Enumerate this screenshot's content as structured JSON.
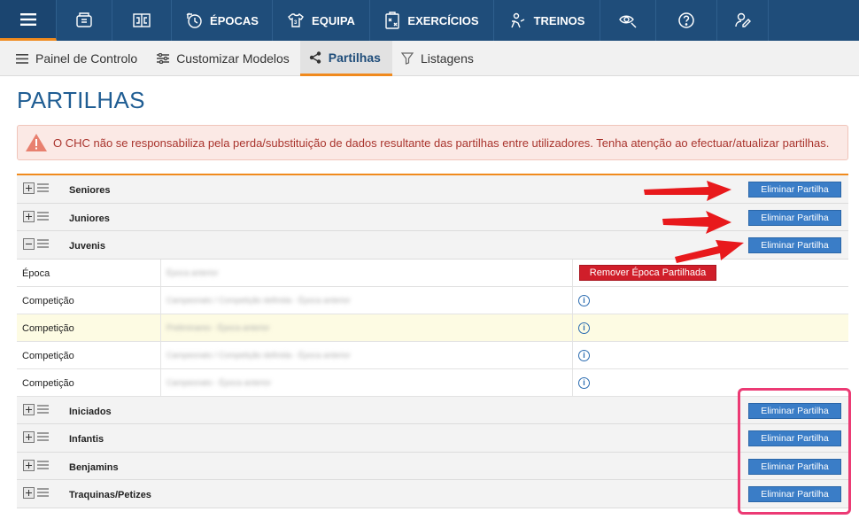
{
  "topnav": {
    "items": [
      {
        "label": "",
        "icon": "menu-icon"
      },
      {
        "label": "",
        "icon": "club-icon"
      },
      {
        "label": "",
        "icon": "field-icon"
      },
      {
        "label": "ÉPOCAS",
        "icon": "seasons-icon"
      },
      {
        "label": "EQUIPA",
        "icon": "team-icon"
      },
      {
        "label": "EXERCÍCIOS",
        "icon": "exercises-icon"
      },
      {
        "label": "TREINOS",
        "icon": "trainings-icon"
      },
      {
        "label": "",
        "icon": "scouting-icon"
      },
      {
        "label": "",
        "icon": "help-icon"
      },
      {
        "label": "",
        "icon": "user-icon"
      }
    ]
  },
  "subnav": {
    "tabs": [
      {
        "label": "Painel de Controlo",
        "icon": "list-icon"
      },
      {
        "label": "Customizar Modelos",
        "icon": "sliders-icon"
      },
      {
        "label": "Partilhas",
        "icon": "share-icon",
        "active": true
      },
      {
        "label": "Listagens",
        "icon": "filter-icon"
      }
    ]
  },
  "page": {
    "title": "PARTILHAS",
    "alert": "O CHC não se responsabiliza pela perda/substituição de dados resultante das partilhas entre utilizadores. Tenha atenção ao efectuar/atualizar partilhas."
  },
  "shares": {
    "delete_label": "Eliminar Partilha",
    "remove_season_label": "Remover Época Partilhada",
    "groups": [
      {
        "name": "Seniores",
        "expanded": false
      },
      {
        "name": "Juniores",
        "expanded": false
      },
      {
        "name": "Juvenis",
        "expanded": true
      },
      {
        "name": "Iniciados",
        "expanded": false
      },
      {
        "name": "Infantis",
        "expanded": false
      },
      {
        "name": "Benjamins",
        "expanded": false
      },
      {
        "name": "Traquinas/Petizes",
        "expanded": false
      }
    ],
    "juvenis_rows": [
      {
        "label": "Época",
        "value": "Época anterior"
      },
      {
        "label": "Competição",
        "value": "Campeonato / Competição definida - Época anterior"
      },
      {
        "label": "Competição",
        "value": "Preliminares - Época anterior"
      },
      {
        "label": "Competição",
        "value": "Campeonato / Competição definida - Época anterior"
      },
      {
        "label": "Competição",
        "value": "Campeonato - Época anterior"
      }
    ]
  },
  "colors": {
    "nav_bg": "#1f4d7a",
    "accent": "#f08a1d",
    "title": "#1f5d93",
    "primary_button": "#3a7dc7",
    "danger_button": "#d01e2a",
    "annotation_arrow": "#e8191c",
    "annotation_box": "#ec3a74"
  }
}
